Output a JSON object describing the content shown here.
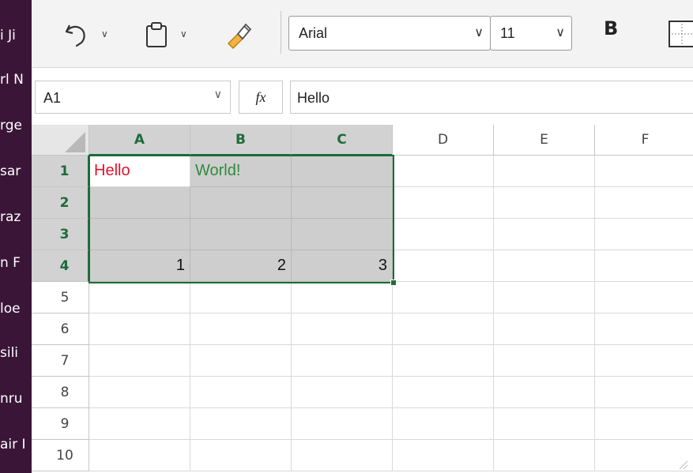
{
  "left_panel": {
    "items": [
      "i Ji",
      "rl N",
      "rge",
      "sar",
      "raz",
      "n F",
      "loe",
      "sili",
      "nru",
      "air I"
    ]
  },
  "toolbar": {
    "font_name": "Arial",
    "font_size": "11",
    "bold_label": "B",
    "dropdown_chevron": "∨",
    "icons": [
      "undo-icon",
      "clipboard-icon",
      "format-painter-icon",
      "borders-icon"
    ]
  },
  "formula_bar": {
    "name_box": "A1",
    "fx_label": "fx",
    "formula": "Hello"
  },
  "grid": {
    "columns": [
      "A",
      "B",
      "C",
      "D",
      "E",
      "F"
    ],
    "rows": [
      "1",
      "2",
      "3",
      "4",
      "5",
      "6",
      "7",
      "8",
      "9",
      "10"
    ],
    "cells": {
      "A1": "Hello",
      "B1": "World!",
      "A4": "1",
      "B4": "2",
      "C4": "3"
    },
    "colors": {
      "A1": "#e0122a",
      "B1": "#2e8b3a",
      "selection": "#1d6b3a",
      "selected_fill": "#cecece"
    },
    "selection_range": "A1:C4",
    "active_cell": "A1"
  },
  "colors": {
    "side_strip": "#3a1538",
    "ribbon_bg": "#f3f3f3"
  }
}
